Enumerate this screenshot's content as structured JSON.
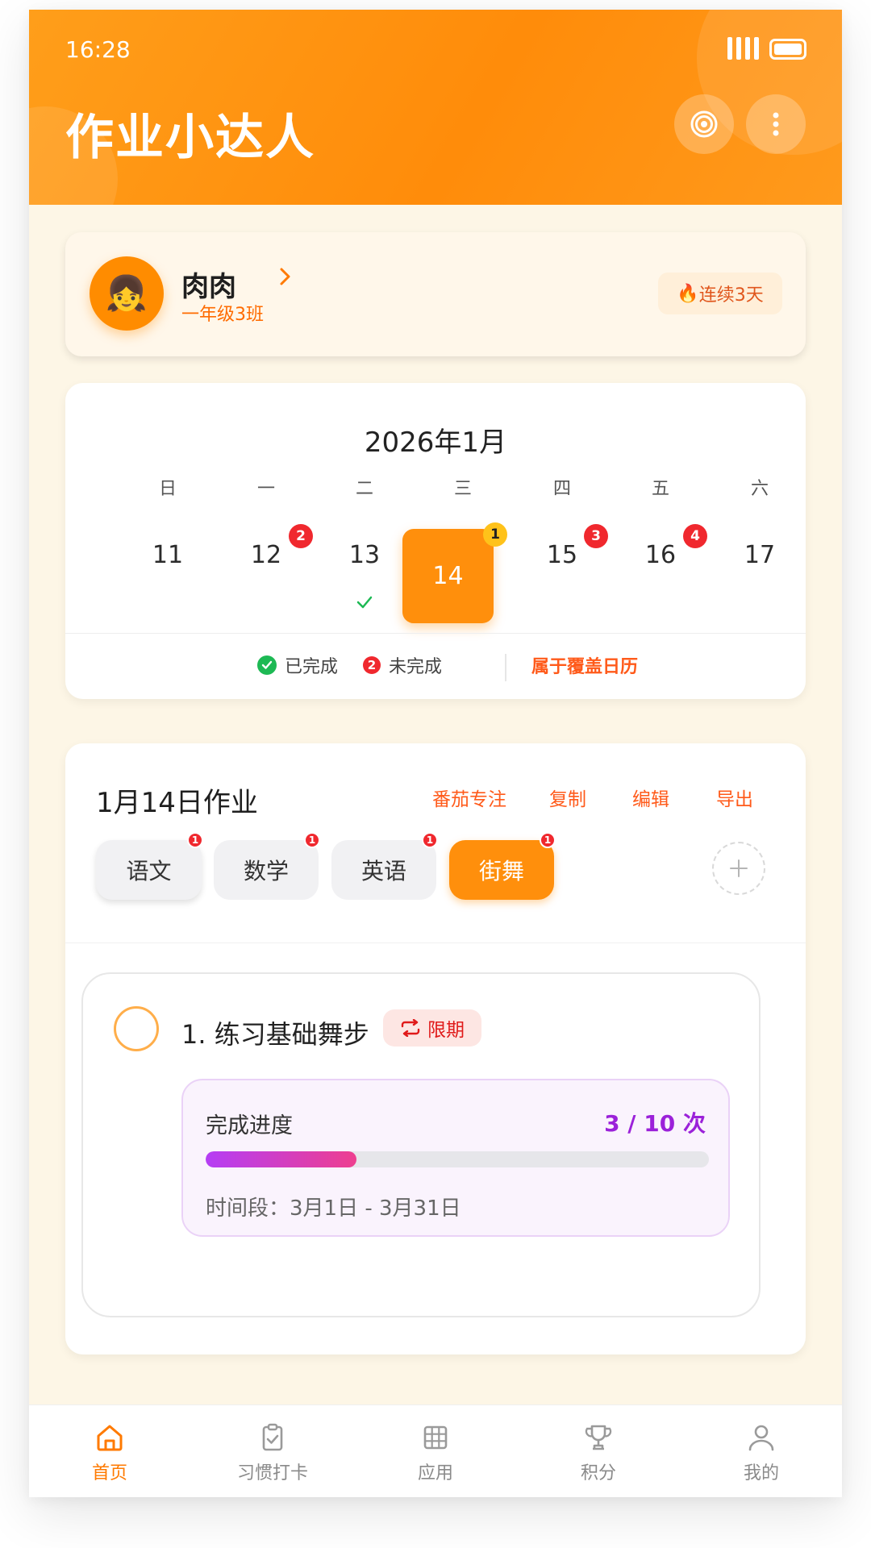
{
  "status_bar": {
    "time": "16:28"
  },
  "header": {
    "title": "作业小达人",
    "target_icon": "target-icon",
    "more_icon": "more-vertical-icon"
  },
  "profile": {
    "avatar_emoji": "👧",
    "name": "肉肉",
    "class": "一年级3班",
    "streak_icon": "🔥",
    "streak": "连续3天"
  },
  "calendar": {
    "title": "2026年1月",
    "weekdays": [
      "日",
      "一",
      "二",
      "三",
      "四",
      "五",
      "六"
    ],
    "days": [
      {
        "num": "11"
      },
      {
        "num": "12",
        "badge": "2"
      },
      {
        "num": "13",
        "done": true
      },
      {
        "num": "14",
        "badge": "1",
        "selected": true
      },
      {
        "num": "15",
        "badge": "3"
      },
      {
        "num": "16",
        "badge": "4"
      },
      {
        "num": "17"
      }
    ],
    "legend": {
      "done_label": "已完成",
      "todo_count": "2",
      "todo_label": "未完成",
      "link": "属于覆盖日历"
    }
  },
  "homework": {
    "title": "1月14日作业",
    "actions": [
      "番茄专注",
      "复制",
      "编辑",
      "导出"
    ],
    "subjects": [
      {
        "label": "语文",
        "dot": "1"
      },
      {
        "label": "数学",
        "dot": "1"
      },
      {
        "label": "英语",
        "dot": "1"
      },
      {
        "label": "街舞",
        "dot": "1",
        "active": true
      }
    ],
    "task": {
      "title": "1. 练习基础舞步",
      "tag": "限期",
      "progress_label": "完成进度",
      "progress_text": "3 / 10 次",
      "progress_fraction": 0.3,
      "period": "时间段：3月1日 - 3月31日"
    }
  },
  "tabbar": [
    {
      "label": "首页",
      "icon": "home-icon",
      "active": true
    },
    {
      "label": "习惯打卡",
      "icon": "clipboard-check-icon"
    },
    {
      "label": "应用",
      "icon": "grid-icon"
    },
    {
      "label": "积分",
      "icon": "trophy-icon"
    },
    {
      "label": "我的",
      "icon": "user-icon"
    }
  ],
  "colors": {
    "accent": "#ff8f0c",
    "danger": "#f0282e",
    "progress": "#9b21d9"
  }
}
